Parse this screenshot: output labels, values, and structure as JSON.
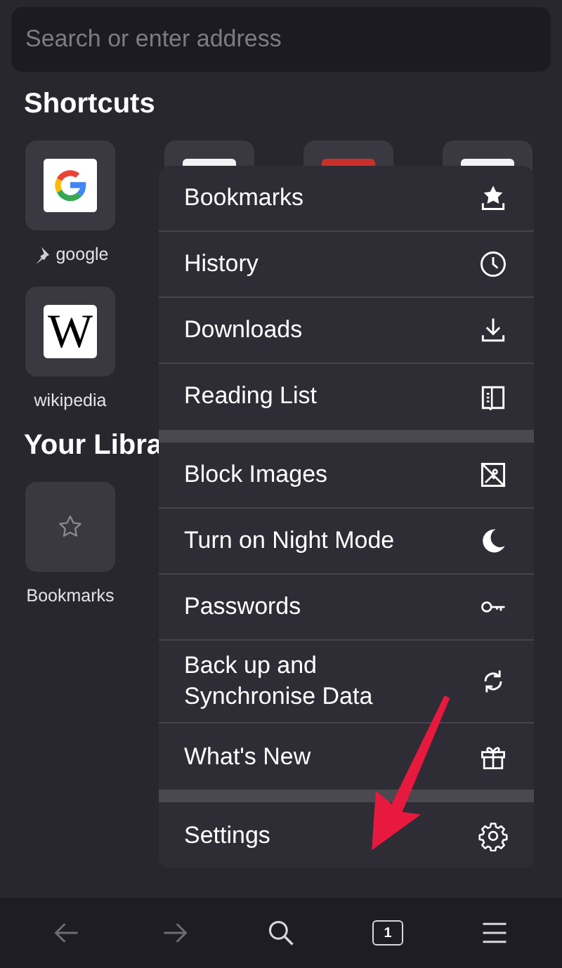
{
  "search": {
    "placeholder": "Search or enter address"
  },
  "shortcuts": {
    "title": "Shortcuts",
    "items": [
      {
        "label": "google",
        "pinned": true
      },
      {
        "color": "#f2f2f2"
      },
      {
        "color": "#c9302c"
      },
      {
        "color": "#f2f2f2"
      },
      {
        "label": "wikipedia",
        "pinned": false,
        "logo": "W"
      }
    ]
  },
  "library": {
    "title": "Your Libra",
    "items": [
      {
        "label": "Bookmarks"
      }
    ]
  },
  "menu": {
    "groups": [
      [
        {
          "label": "Bookmarks"
        },
        {
          "label": "History"
        },
        {
          "label": "Downloads"
        },
        {
          "label": "Reading List"
        }
      ],
      [
        {
          "label": "Block Images"
        },
        {
          "label": "Turn on Night Mode"
        },
        {
          "label": "Passwords"
        },
        {
          "label": "Back up and\nSynchronise Data"
        },
        {
          "label": "What's New"
        }
      ],
      [
        {
          "label": "Settings"
        }
      ]
    ]
  },
  "toolbar": {
    "tab_count": "1"
  }
}
